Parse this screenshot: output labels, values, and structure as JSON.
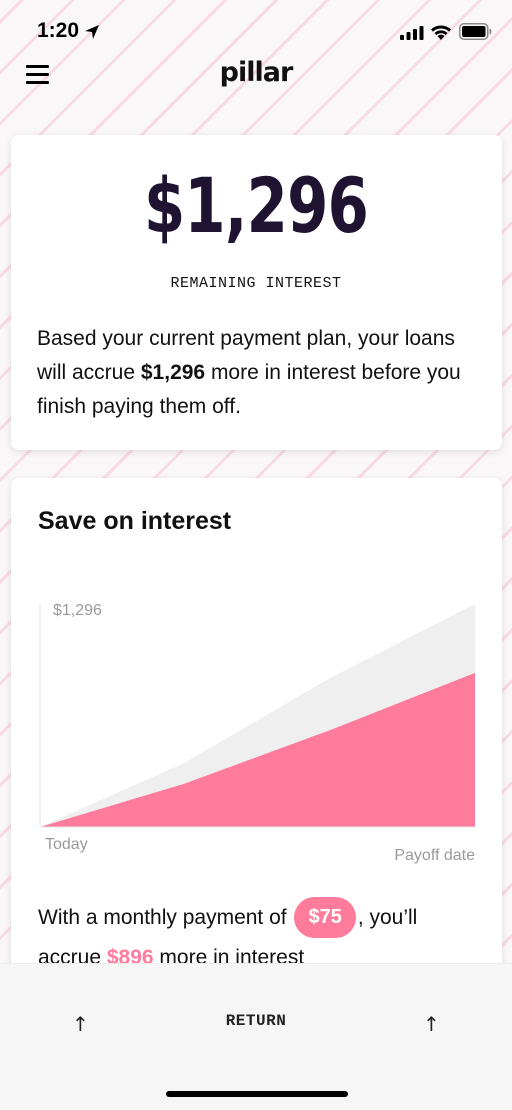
{
  "status": {
    "time": "1:20"
  },
  "header": {
    "brand": "pillar"
  },
  "interest_card": {
    "amount": "$1,296",
    "label": "REMAINING INTEREST",
    "description_prefix": "Based your current payment plan, your loans will accrue ",
    "description_amount": "$1,296",
    "description_suffix": " more in interest before you finish paying them off."
  },
  "savings_card": {
    "title": "Save on interest",
    "payment_prefix": "With a monthly payment of ",
    "payment_amount": "$75",
    "payment_suffix": ", you’ll",
    "accrue_prefix": "accrue ",
    "accrue_amount": "$896",
    "accrue_suffix": " more in interest"
  },
  "chart_data": {
    "type": "area",
    "x_start_label": "Today",
    "x_end_label": "Payoff date",
    "y_max_label": "$1,296",
    "ylim": [
      0,
      1296
    ],
    "series": [
      {
        "color": "#efefef",
        "values": [
          0,
          370,
          870,
          1296
        ]
      },
      {
        "color": "#ff7b9b",
        "values": [
          0,
          250,
          566,
          896
        ]
      }
    ],
    "x": [
      0,
      0.33,
      0.67,
      1
    ]
  },
  "bottom_bar": {
    "return_label": "RETURN",
    "left_arrow": "↑",
    "right_arrow": "↑"
  },
  "colors": {
    "accent": "#ff7b9b",
    "amount_text": "#1e1432",
    "baseline_area": "#efefef"
  }
}
